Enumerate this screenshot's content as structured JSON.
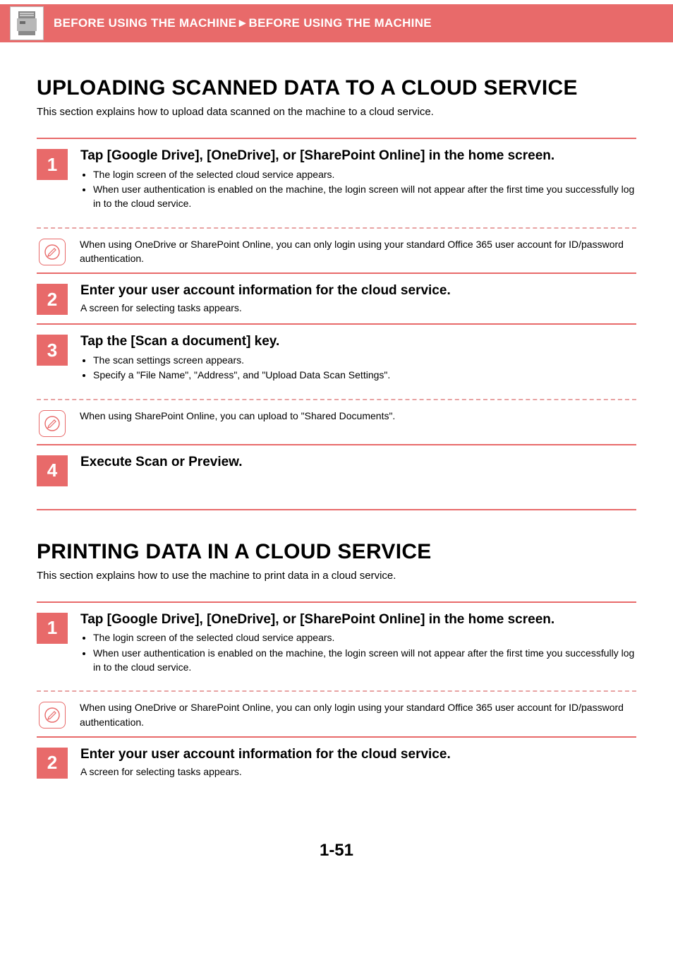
{
  "header": {
    "breadcrumb_left": "BEFORE USING THE MACHINE",
    "breadcrumb_sep": "►",
    "breadcrumb_right": "BEFORE USING THE MACHINE"
  },
  "section1": {
    "title": "UPLOADING SCANNED DATA TO A CLOUD SERVICE",
    "intro": "This section explains how to upload data scanned on the machine to a cloud service.",
    "steps": [
      {
        "num": "1",
        "heading": "Tap [Google Drive], [OneDrive], or [SharePoint Online] in the home screen.",
        "bullets": [
          "The login screen of the selected cloud service appears.",
          "When user authentication is enabled on the machine, the login screen will not appear after the first time you successfully log in to the cloud service."
        ],
        "note": "When using OneDrive or SharePoint Online, you can only login using your standard Office 365 user account for ID/password authentication."
      },
      {
        "num": "2",
        "heading": "Enter your user account information for the cloud service.",
        "plain": "A screen for selecting tasks appears."
      },
      {
        "num": "3",
        "heading": "Tap the [Scan a document] key.",
        "bullets": [
          "The scan settings screen appears.",
          "Specify a \"File Name\", \"Address\", and \"Upload Data Scan Settings\"."
        ],
        "note": "When using SharePoint Online, you can upload to \"Shared Documents\"."
      },
      {
        "num": "4",
        "heading": "Execute Scan or Preview."
      }
    ]
  },
  "section2": {
    "title": "PRINTING DATA IN A CLOUD SERVICE",
    "intro": "This section explains how to use the machine to print data in a cloud service.",
    "steps": [
      {
        "num": "1",
        "heading": "Tap [Google Drive], [OneDrive], or [SharePoint Online] in the home screen.",
        "bullets": [
          "The login screen of the selected cloud service appears.",
          "When user authentication is enabled on the machine, the login screen will not appear after the first time you successfully log in to the cloud service."
        ],
        "note": "When using OneDrive or SharePoint Online, you can only login using your standard Office 365 user account for ID/password authentication."
      },
      {
        "num": "2",
        "heading": "Enter your user account information for the cloud service.",
        "plain": "A screen for selecting tasks appears."
      }
    ]
  },
  "page_number": "1-51"
}
